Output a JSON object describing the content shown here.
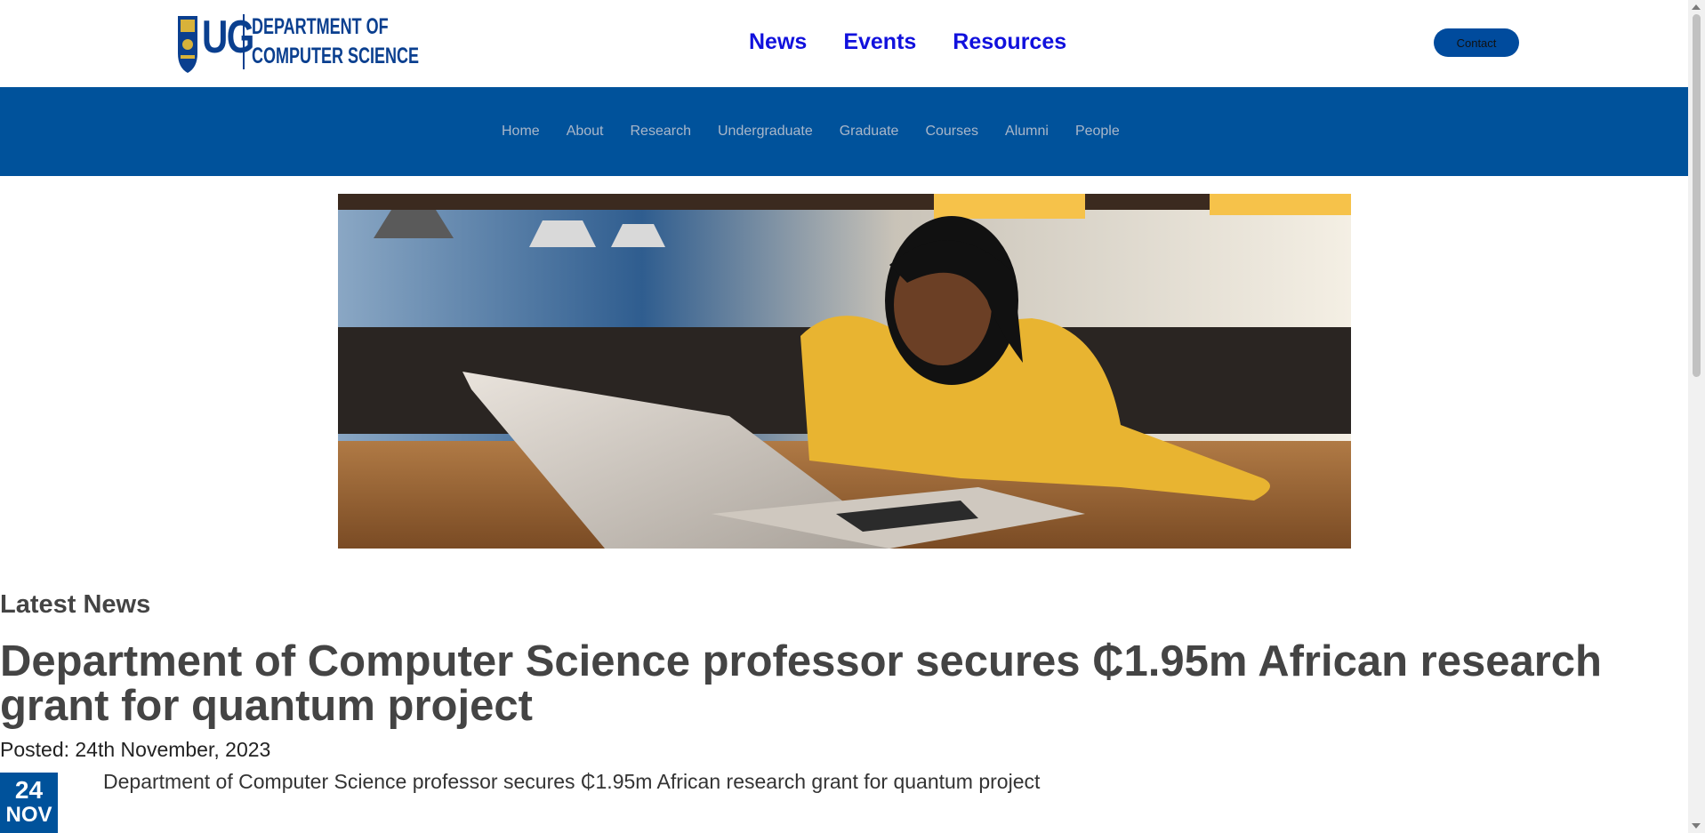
{
  "logo": {
    "initials": "UG",
    "dept_line1": "DEPARTMENT OF",
    "dept_line2": "COMPUTER SCIENCE"
  },
  "top_nav": {
    "news": "News",
    "events": "Events",
    "resources": "Resources"
  },
  "contact_label": "Contact",
  "main_nav": [
    "Home",
    "About",
    "Research",
    "Undergraduate",
    "Graduate",
    "Courses",
    "Alumni",
    "People"
  ],
  "hero": {
    "icon": "hero-photo-student-laptop"
  },
  "latest_news": {
    "section_title": "Latest News",
    "headline": "Department of Computer Science professor secures ₵1.95m African research grant for quantum project",
    "posted": "Posted: 24th November, 2023",
    "date_day": "24",
    "date_month": "NOV",
    "summary": "Department of Computer Science professor secures ₵1.95m African research grant for quantum project"
  },
  "colors": {
    "brand_blue": "#00529b",
    "nav_link": "#1111dd",
    "text": "#444444"
  }
}
